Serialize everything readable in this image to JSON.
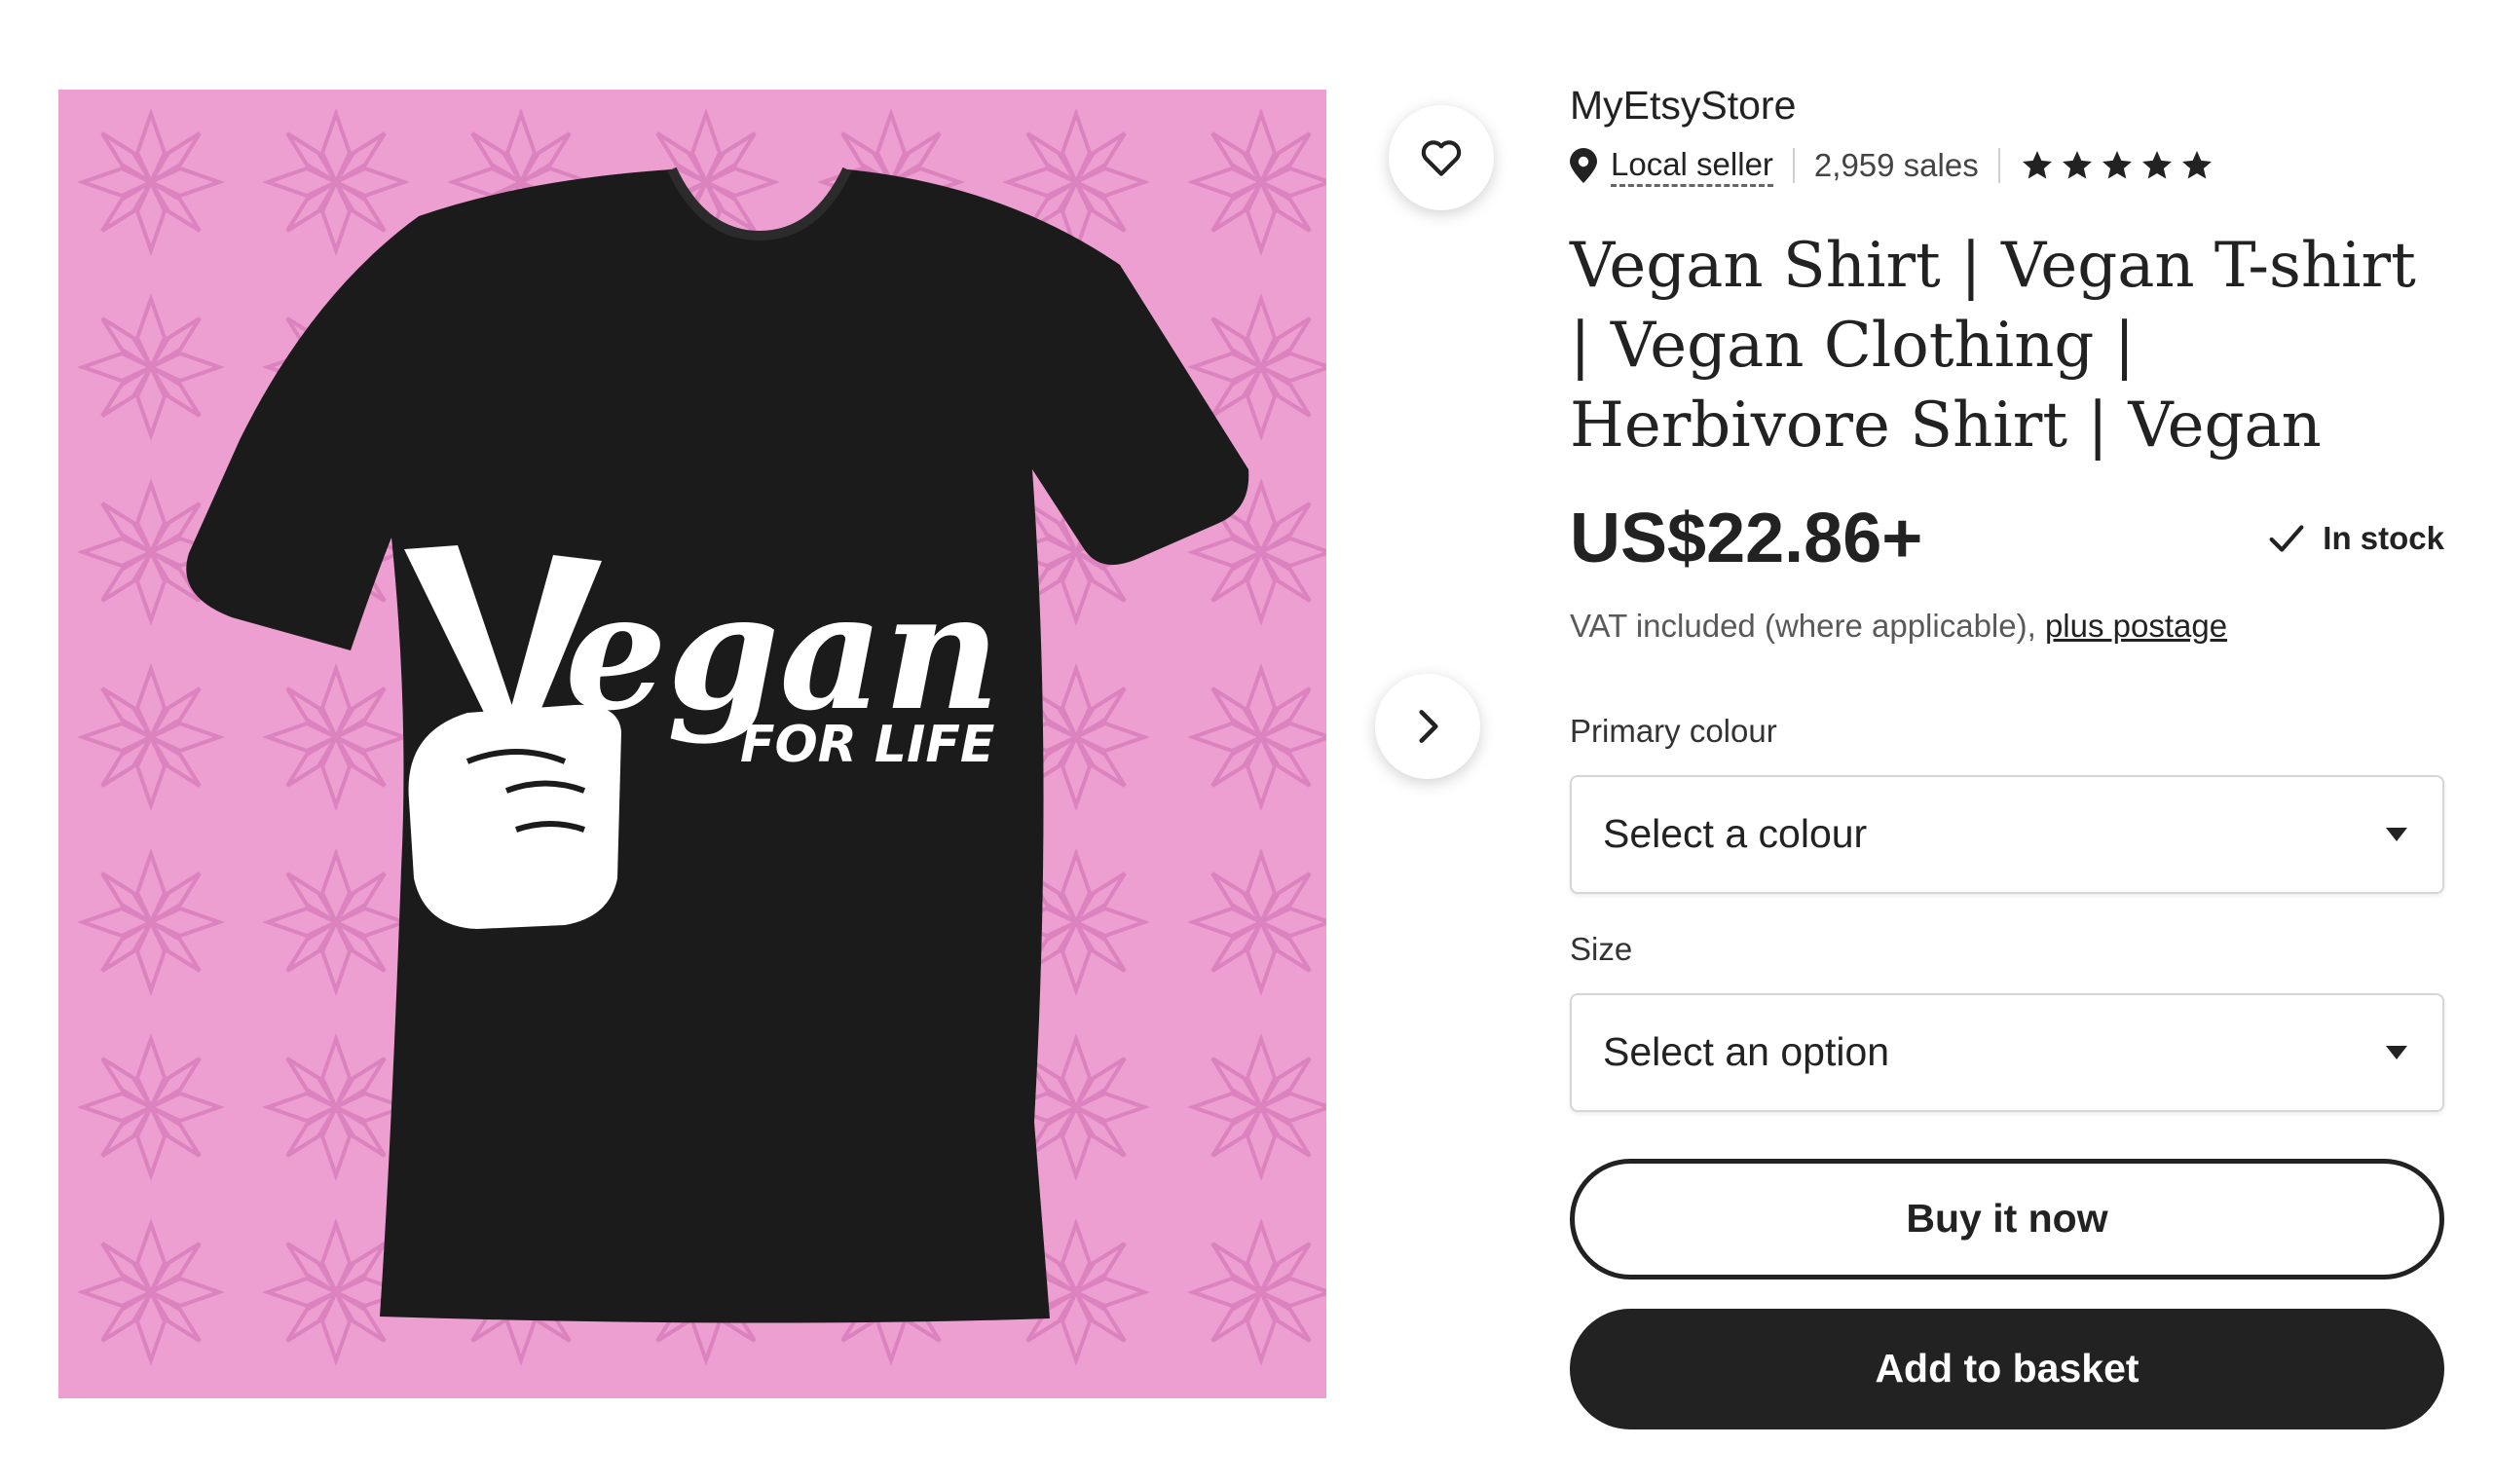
{
  "product_image": {
    "graphic_text": {
      "word": "egan",
      "subline": "FOR LIFE"
    },
    "colors": {
      "background": "#ec9fd0",
      "pattern": "#db82bf",
      "shirt": "#1b1b1b",
      "print": "#ffffff"
    }
  },
  "icons": {
    "favorite": "heart-icon",
    "next": "chevron-right-icon",
    "location": "location-pin-icon",
    "rating": "star-icon",
    "stock": "checkmark-icon",
    "dropdown": "caret-down-icon"
  },
  "shop": {
    "name": "MyEtsyStore",
    "local_seller": "Local seller",
    "sales": "2,959 sales",
    "rating_stars": 5
  },
  "product": {
    "title": "Vegan Shirt | Vegan T-shirt | Vegan Clothing | Herbivore Shirt | Vegan",
    "price": "US$22.86+",
    "stock": "In stock",
    "vat_text": "VAT included (where applicable),",
    "postage_link": "plus postage"
  },
  "options": {
    "colour": {
      "label": "Primary colour",
      "value": "Select a colour"
    },
    "size": {
      "label": "Size",
      "value": "Select an option"
    }
  },
  "actions": {
    "buy_now": "Buy it now",
    "add_to_basket": "Add to basket"
  }
}
